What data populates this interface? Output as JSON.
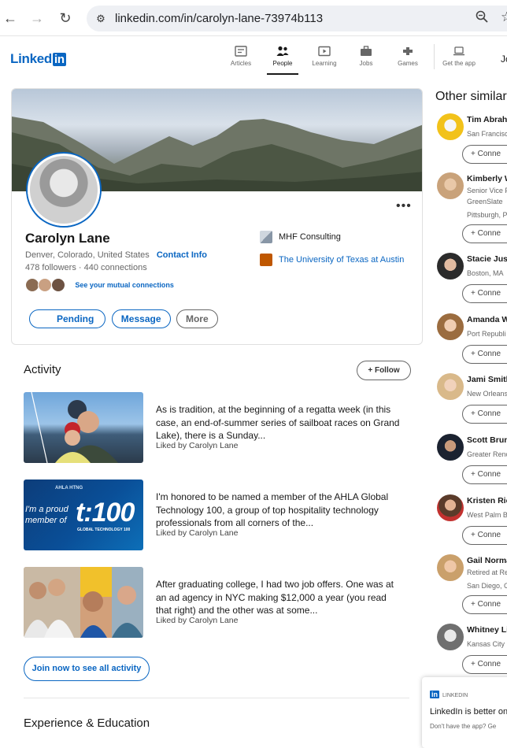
{
  "browser": {
    "url": "linkedin.com/in/carolyn-lane-73974b113"
  },
  "nav": {
    "logo_text": "Linked",
    "logo_in": "in",
    "items": [
      {
        "label": "Articles",
        "icon": "articles-icon"
      },
      {
        "label": "People",
        "icon": "people-icon"
      },
      {
        "label": "Learning",
        "icon": "learning-icon"
      },
      {
        "label": "Jobs",
        "icon": "jobs-icon"
      },
      {
        "label": "Games",
        "icon": "games-icon"
      },
      {
        "label": "Get the app",
        "icon": "laptop-icon"
      }
    ],
    "join_truncated": "Jo"
  },
  "profile": {
    "name": "Carolyn Lane",
    "location": "Denver, Colorado, United States",
    "contact_link": "Contact Info",
    "followers": "478 followers",
    "connections": "440 connections",
    "mutual_link": "See your mutual connections",
    "buttons": {
      "pending": "Pending",
      "message": "Message",
      "more": "More"
    },
    "company": "MHF Consulting",
    "school": "The University of Texas at Austin"
  },
  "activity": {
    "title": "Activity",
    "follow_label": "Follow",
    "posts": [
      {
        "text": "As is tradition, at the beginning of a regatta week (in this case, an end-of-summer series of sailboat races on Grand Lake), there is a Sunday...",
        "liked": "Liked by Carolyn Lane"
      },
      {
        "text": "I'm honored to be named a member of the AHLA Global Technology 100, a group of top hospitality technology professionals from all corners of the...",
        "liked": "Liked by Carolyn Lane",
        "thumb_line1": "I'm a proud",
        "thumb_line2": "member of",
        "thumb_brand": "t:100",
        "thumb_small": "GLOBAL TECHNOLOGY 100",
        "thumb_top": "AHLA HTNG"
      },
      {
        "text": "After graduating college, I had two job offers. One was at an ad agency in NYC making $12,000 a year (you read that right) and the other was at some...",
        "liked": "Liked by Carolyn Lane"
      }
    ],
    "join_label": "Join now to see all activity"
  },
  "experience_title": "Experience & Education",
  "similar": {
    "title": "Other similar",
    "connect_label": "Conne",
    "people": [
      {
        "name": "Tim Abraha",
        "sub": [
          "San Francisco"
        ]
      },
      {
        "name": "Kimberly W",
        "sub": [
          "Senior Vice P",
          "GreenSlate",
          "Pittsburgh, P"
        ]
      },
      {
        "name": "Stacie Justi",
        "sub": [
          "Boston, MA"
        ]
      },
      {
        "name": "Amanda W",
        "sub": [
          "Port Republi"
        ]
      },
      {
        "name": "Jami Smith",
        "sub": [
          "New Orleans"
        ]
      },
      {
        "name": "Scott Brum",
        "sub": [
          "Greater Renc"
        ]
      },
      {
        "name": "Kristen Ric",
        "sub": [
          "West Palm B"
        ]
      },
      {
        "name": "Gail Norma",
        "sub": [
          "Retired at Re",
          "San Diego, C"
        ]
      },
      {
        "name": "Whitney Li",
        "sub": [
          "Kansas City"
        ]
      }
    ]
  },
  "popup": {
    "badge": "in",
    "brand": "LINKEDIN",
    "headline": "LinkedIn is better on",
    "sub": "Don't have the app? Ge"
  },
  "colors": {
    "brand": "#0a66c2",
    "text": "#191919",
    "muted": "#666666"
  }
}
